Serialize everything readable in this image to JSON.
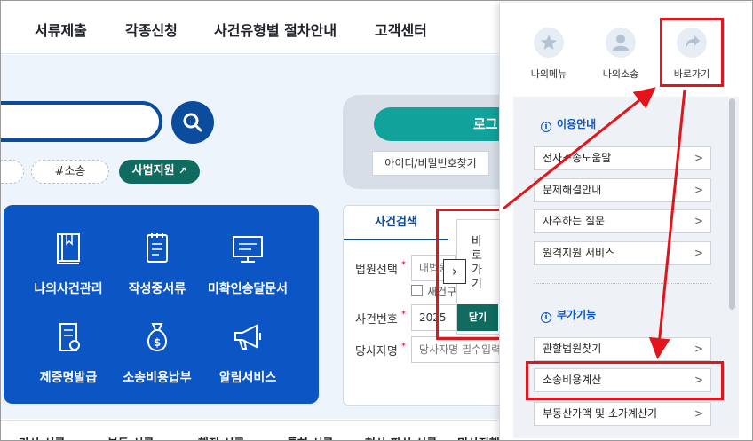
{
  "top_nav": [
    "서류제출",
    "각종신청",
    "사건유형별 절차안내",
    "고객센터"
  ],
  "search": {
    "tags": [
      "#소송"
    ],
    "link_button": "사법지원"
  },
  "login": {
    "button": "로그",
    "find_button": "아이디/비밀번호찾기"
  },
  "services": [
    {
      "label": "나의사건관리",
      "icon": "book-icon"
    },
    {
      "label": "작성중서류",
      "icon": "notepad-icon"
    },
    {
      "label": "미확인송달문서",
      "icon": "monitor-icon"
    },
    {
      "label": "제증명발급",
      "icon": "certificate-icon"
    },
    {
      "label": "소송비용납부",
      "icon": "money-bag-icon"
    },
    {
      "label": "알림서비스",
      "icon": "megaphone-icon"
    }
  ],
  "case_search": {
    "tab": "사건검색",
    "court_label": "법원선택",
    "court_value": "대법원",
    "new_case_checkbox": "새건구",
    "case_no_label": "사건번호",
    "year_value": "2025",
    "party_label": "당사자명",
    "party_placeholder": "당사자명 필수입력"
  },
  "float_panel": {
    "text": "바로가기",
    "close": "닫기",
    "arrow": "›"
  },
  "bottom_row": [
    "가사 서류",
    "부동 서류",
    "행정 서류",
    "특허 서류",
    "형사·파산 서류",
    "민사진행"
  ],
  "side_menu": {
    "top_icons": [
      {
        "label": "나의메뉴",
        "icon": "star-icon"
      },
      {
        "label": "나의소송",
        "icon": "person-icon"
      },
      {
        "label": "바로가기",
        "icon": "share-arrow-icon"
      }
    ],
    "sections": [
      {
        "title": "이용안내",
        "items": [
          "전자소송도움말",
          "문제해결안내",
          "자주하는 질문",
          "원격지원 서비스"
        ]
      },
      {
        "title": "부가기능",
        "items": [
          "관할법원찾기",
          "소송비용계산",
          "부동산가액 및 소가계산기"
        ]
      }
    ]
  },
  "colors": {
    "primary": "#0b4c9c",
    "panel_blue": "#0b56c4",
    "teal": "#10a29b",
    "green": "#0f6b5f",
    "highlight_red": "#e2151c"
  }
}
